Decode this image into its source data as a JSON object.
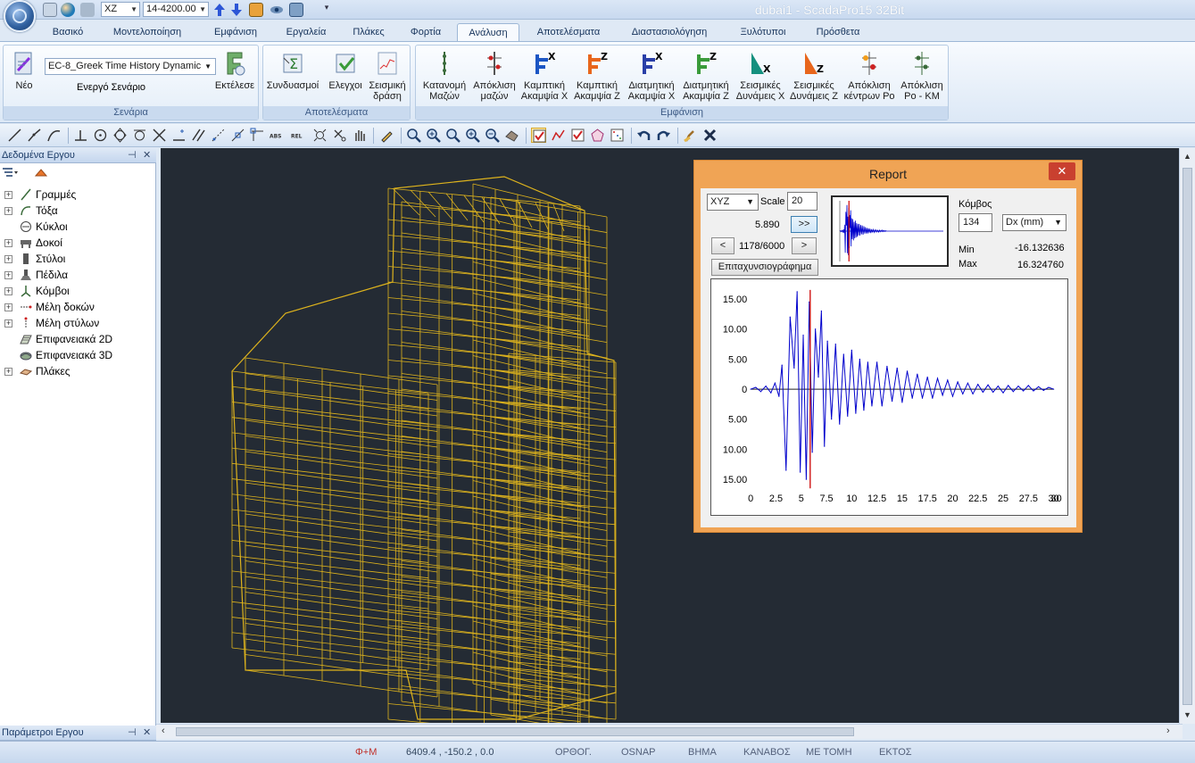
{
  "app": {
    "title": "dubai1 - ScadaPro15 32Bit",
    "quick_access": {
      "plane_value": "XZ",
      "level_value": "14-4200.00"
    }
  },
  "ribbon": {
    "tabs": [
      "Βασικό",
      "Μοντελοποίηση",
      "Εμφάνιση",
      "Εργαλεία",
      "Πλάκες",
      "Φορτία",
      "Ανάλυση",
      "Αποτελέσματα",
      "Διαστασιολόγηση",
      "Ξυλότυποι",
      "Πρόσθετα"
    ],
    "active_tab": "Ανάλυση",
    "scenarios_group": {
      "label": "Σενάρια",
      "new_label": "Νέο",
      "scenario_value": "EC-8_Greek Time History Dynamic",
      "active_scenario_label": "Ενεργό Σενάριο",
      "run_label": "Εκτέλεσε"
    },
    "results_group": {
      "label": "Αποτελέσματα",
      "buttons": [
        {
          "line1": "Συνδυασμοί",
          "line2": ""
        },
        {
          "line1": "Ελεγχοι",
          "line2": ""
        },
        {
          "line1": "Σεισμική",
          "line2": "δράση"
        }
      ]
    },
    "display_group": {
      "label": "Εμφάνιση",
      "buttons": [
        {
          "line1": "Κατανομή",
          "line2": "Μαζών"
        },
        {
          "line1": "Απόκλιση",
          "line2": "μαζών"
        },
        {
          "line1": "Καμπτική",
          "line2": "Ακαμψία Χ"
        },
        {
          "line1": "Καμπτική",
          "line2": "Ακαμψία Ζ"
        },
        {
          "line1": "Διατμητική",
          "line2": "Ακαμψία Χ"
        },
        {
          "line1": "Διατμητική",
          "line2": "Ακαμψία Ζ"
        },
        {
          "line1": "Σεισμικές",
          "line2": "Δυνάμεις Χ"
        },
        {
          "line1": "Σεισμικές",
          "line2": "Δυνάμεις Ζ"
        },
        {
          "line1": "Απόκλιση",
          "line2": "κέντρων Ρο"
        },
        {
          "line1": "Απόκλιση",
          "line2": "Ρο - ΚΜ"
        }
      ]
    }
  },
  "left_panel": {
    "title": "Δεδομένα Εργου",
    "bottom_title": "Παράμετροι Εργου",
    "tree": [
      {
        "label": "Γραμμές",
        "expandable": true
      },
      {
        "label": "Τόξα",
        "expandable": true
      },
      {
        "label": "Κύκλοι",
        "expandable": false
      },
      {
        "label": "Δοκοί",
        "expandable": true
      },
      {
        "label": "Στύλοι",
        "expandable": true
      },
      {
        "label": "Πέδιλα",
        "expandable": true
      },
      {
        "label": "Κόμβοι",
        "expandable": true
      },
      {
        "label": "Μέλη δοκών",
        "expandable": true
      },
      {
        "label": "Μέλη στύλων",
        "expandable": true
      },
      {
        "label": "Επιφανειακά 2D",
        "expandable": false
      },
      {
        "label": "Επιφανειακά 3D",
        "expandable": false
      },
      {
        "label": "Πλάκες",
        "expandable": true
      }
    ]
  },
  "report": {
    "title": "Report",
    "close_label": "✕",
    "direction_value": "XYZ",
    "scale_label": "Scale",
    "scale_value": "20",
    "time_value": "5.890",
    "play_label": ">>",
    "prev_label": "<",
    "step_value": "1178/6000",
    "next_label": ">",
    "accelerogram_label": "Επιταχυνσιογράφημα",
    "node_label": "Κόμβος",
    "node_value": "134",
    "quantity_value": "Dx (mm)",
    "min_label": "Min",
    "min_value": "-16.132636",
    "max_label": "Max",
    "max_value": "16.324760"
  },
  "chart_data": {
    "type": "line",
    "title": "",
    "xlabel": "",
    "ylabel": "",
    "xlim": [
      0,
      30
    ],
    "ylim": [
      -16.5,
      16.5
    ],
    "xticks": [
      "0",
      "2.5",
      "5",
      "7.5",
      "10",
      "12.5",
      "15",
      "17.5",
      "20",
      "22.5",
      "25",
      "27.5",
      "30",
      "30"
    ],
    "yticks": [
      {
        "value": 15,
        "label": "15.00"
      },
      {
        "value": 10,
        "label": "10.00"
      },
      {
        "value": 5,
        "label": "5.00"
      },
      {
        "value": 0,
        "label": "0"
      },
      {
        "value": -5,
        "label": "5.00"
      },
      {
        "value": -10,
        "label": "10.00"
      },
      {
        "value": -15,
        "label": "15.00"
      }
    ],
    "cursor_x": 5.89,
    "series": [
      {
        "color": "#0000cc",
        "x": [
          0,
          0.5,
          1,
          1.5,
          2,
          2.4,
          2.8,
          3.1,
          3.5,
          3.9,
          4.3,
          4.6,
          4.9,
          5.2,
          5.5,
          5.8,
          6.1,
          6.4,
          6.7,
          7.0,
          7.3,
          7.6,
          8.0,
          8.4,
          8.8,
          9.2,
          9.6,
          10.0,
          10.4,
          10.8,
          11.2,
          11.6,
          12.0,
          12.5,
          13.0,
          13.5,
          14.0,
          14.5,
          15.0,
          15.5,
          16.0,
          16.5,
          17.0,
          17.5,
          18.0,
          18.5,
          19.0,
          19.5,
          20.0,
          20.5,
          21.0,
          21.5,
          22.0,
          22.5,
          23.0,
          23.5,
          24.0,
          24.5,
          25.0,
          25.5,
          26.0,
          26.5,
          27.0,
          27.5,
          28.0,
          28.5,
          29.0,
          29.5,
          30.0
        ],
        "y": [
          0,
          0.3,
          -0.4,
          0.5,
          -0.6,
          1.0,
          -1.2,
          4.0,
          -13.5,
          12.0,
          3.5,
          16.2,
          -13.8,
          9.0,
          -15.0,
          14.5,
          -10.5,
          10.0,
          2.0,
          13.0,
          -9.5,
          8.0,
          -5.0,
          7.5,
          -5.8,
          5.8,
          -4.5,
          6.5,
          -4.0,
          5.0,
          -3.5,
          4.5,
          -2.8,
          4.5,
          -2.8,
          3.8,
          -2.0,
          3.5,
          -2.2,
          3.0,
          -1.5,
          2.5,
          -1.5,
          2.0,
          -1.5,
          1.8,
          -1.0,
          1.5,
          -1.2,
          1.2,
          -0.8,
          1.0,
          -0.8,
          0.8,
          -0.5,
          0.7,
          -0.5,
          0.5,
          -0.6,
          0.6,
          -0.4,
          0.5,
          -0.3,
          0.6,
          -0.3,
          0.4,
          -0.2,
          0.3,
          0
        ]
      }
    ]
  },
  "status_bar": {
    "snap_symbol": "Φ+Μ",
    "coords": "6409.4 , -150.2 , 0.0",
    "items": [
      "ΟΡΘΟΓ.",
      "OSNAP",
      "ΒΗΜΑ",
      "ΚΑΝΑΒΟΣ",
      "ΜΕ ΤΟΜΗ",
      "ΕΚΤΟΣ"
    ]
  },
  "colors": {
    "accent": "#f0a455",
    "viewport_bg": "#242b34",
    "wireframe": "#f2c21b",
    "trace": "#0000cc",
    "cursor": "#cc0000"
  }
}
